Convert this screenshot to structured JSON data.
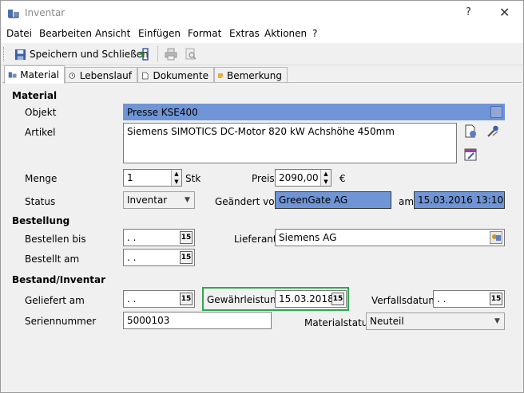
{
  "window": {
    "title": "Inventar",
    "help_label": "?",
    "close_label": "✕"
  },
  "menu": [
    "Datei",
    "Bearbeiten",
    "Ansicht",
    "Einfügen",
    "Format",
    "Extras",
    "Aktionen",
    "?"
  ],
  "toolbar": {
    "save_close_label": "Speichern und Schließen"
  },
  "tabs": [
    "Material",
    "Lebenslauf",
    "Dokumente",
    "Bemerkung"
  ],
  "sections": {
    "material": "Material",
    "bestellung": "Bestellung",
    "bestand": "Bestand/Inventar"
  },
  "fields": {
    "objekt": {
      "label": "Objekt",
      "value": "Presse KSE400"
    },
    "artikel": {
      "label": "Artikel",
      "value": "Siemens SIMOTICS DC-Motor 820 kW  Achshöhe 450mm"
    },
    "menge": {
      "label": "Menge",
      "value": "1",
      "unit": "Stk"
    },
    "preis": {
      "label": "Preis",
      "value": "2090,00",
      "unit": "€"
    },
    "status": {
      "label": "Status",
      "value": "Inventar"
    },
    "geaendert_von": {
      "label": "Geändert von",
      "value": "GreenGate AG"
    },
    "am": {
      "label": "am",
      "value": "15.03.2016 13:10"
    },
    "bestellen_bis": {
      "label": "Bestellen bis",
      "value": ". ."
    },
    "lieferant": {
      "label": "Lieferant",
      "value": "Siemens AG"
    },
    "bestellt_am": {
      "label": "Bestellt am",
      "value": ". ."
    },
    "geliefert_am": {
      "label": "Geliefert am",
      "value": ". ."
    },
    "gewaehrleistung": {
      "label": "Gewährleistung",
      "value": "15.03.2018"
    },
    "verfallsdatum": {
      "label": "Verfallsdatum",
      "value": ". ."
    },
    "seriennummer": {
      "label": "Seriennummer",
      "value": "5000103"
    },
    "materialstatus": {
      "label": "Materialstatus",
      "value": "Neuteil"
    }
  },
  "calendar_glyph": "15",
  "colors": {
    "highlight_blue": "#6f95d6",
    "green_highlight": "#2fa84f"
  }
}
